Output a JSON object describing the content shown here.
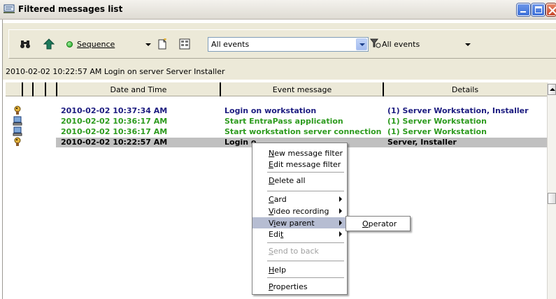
{
  "window": {
    "title": "Filtered messages list"
  },
  "toolbar": {
    "sort_mode": "Sequence",
    "event_filter": "All events",
    "type_filter": "All events",
    "icons": [
      "binoculars-icon",
      "up-arrow-icon",
      "new-document-icon",
      "details-icon",
      "filter-icon"
    ]
  },
  "status_line": "2010-02-02 10:22:57 AM Login on server  Server  Installer",
  "table": {
    "columns": [
      "Date and Time",
      "Event message",
      "Details"
    ],
    "rows": [
      {
        "icon": "operator-key-icon",
        "date": "2010-02-02 10:37:34 AM",
        "message": "Login on workstation",
        "details": "(1) Server Workstation, Installer",
        "color": "#1c1c80"
      },
      {
        "icon": "workstation-icon",
        "date": "2010-02-02 10:36:17 AM",
        "message": "Start EntraPass application",
        "details": "(1) Server Workstation",
        "color": "#2e9b1f"
      },
      {
        "icon": "workstation-icon",
        "date": "2010-02-02 10:36:17 AM",
        "message": "Start workstation server connection",
        "details": "(1) Server Workstation",
        "color": "#2e9b1f"
      },
      {
        "icon": "operator-key-icon",
        "date": "2010-02-02 10:22:57 AM",
        "message": "Login o",
        "details": "Server, Installer",
        "color": "#000000"
      }
    ]
  },
  "context_menu": {
    "items": [
      {
        "label": "New message filter",
        "underline": "N"
      },
      {
        "label": "Edit message filter",
        "underline": "E"
      },
      {
        "label": "Delete all",
        "underline": "D"
      },
      {
        "label": "Card",
        "underline": "C",
        "submenu": true
      },
      {
        "label": "Video recording",
        "underline": "V",
        "submenu": true
      },
      {
        "label": "View parent",
        "underline": "i",
        "submenu": true,
        "highlighted": true
      },
      {
        "label": "Edit",
        "underline": "t",
        "submenu": true
      },
      {
        "label": "Send to back",
        "underline": "S",
        "disabled": true
      },
      {
        "label": "Help",
        "underline": "H"
      },
      {
        "label": "Properties",
        "underline": "P"
      }
    ],
    "submenu_item": "Operator"
  },
  "colors": {
    "highlight": "#b6bdd2",
    "selected_row": "#c0c0c0"
  }
}
